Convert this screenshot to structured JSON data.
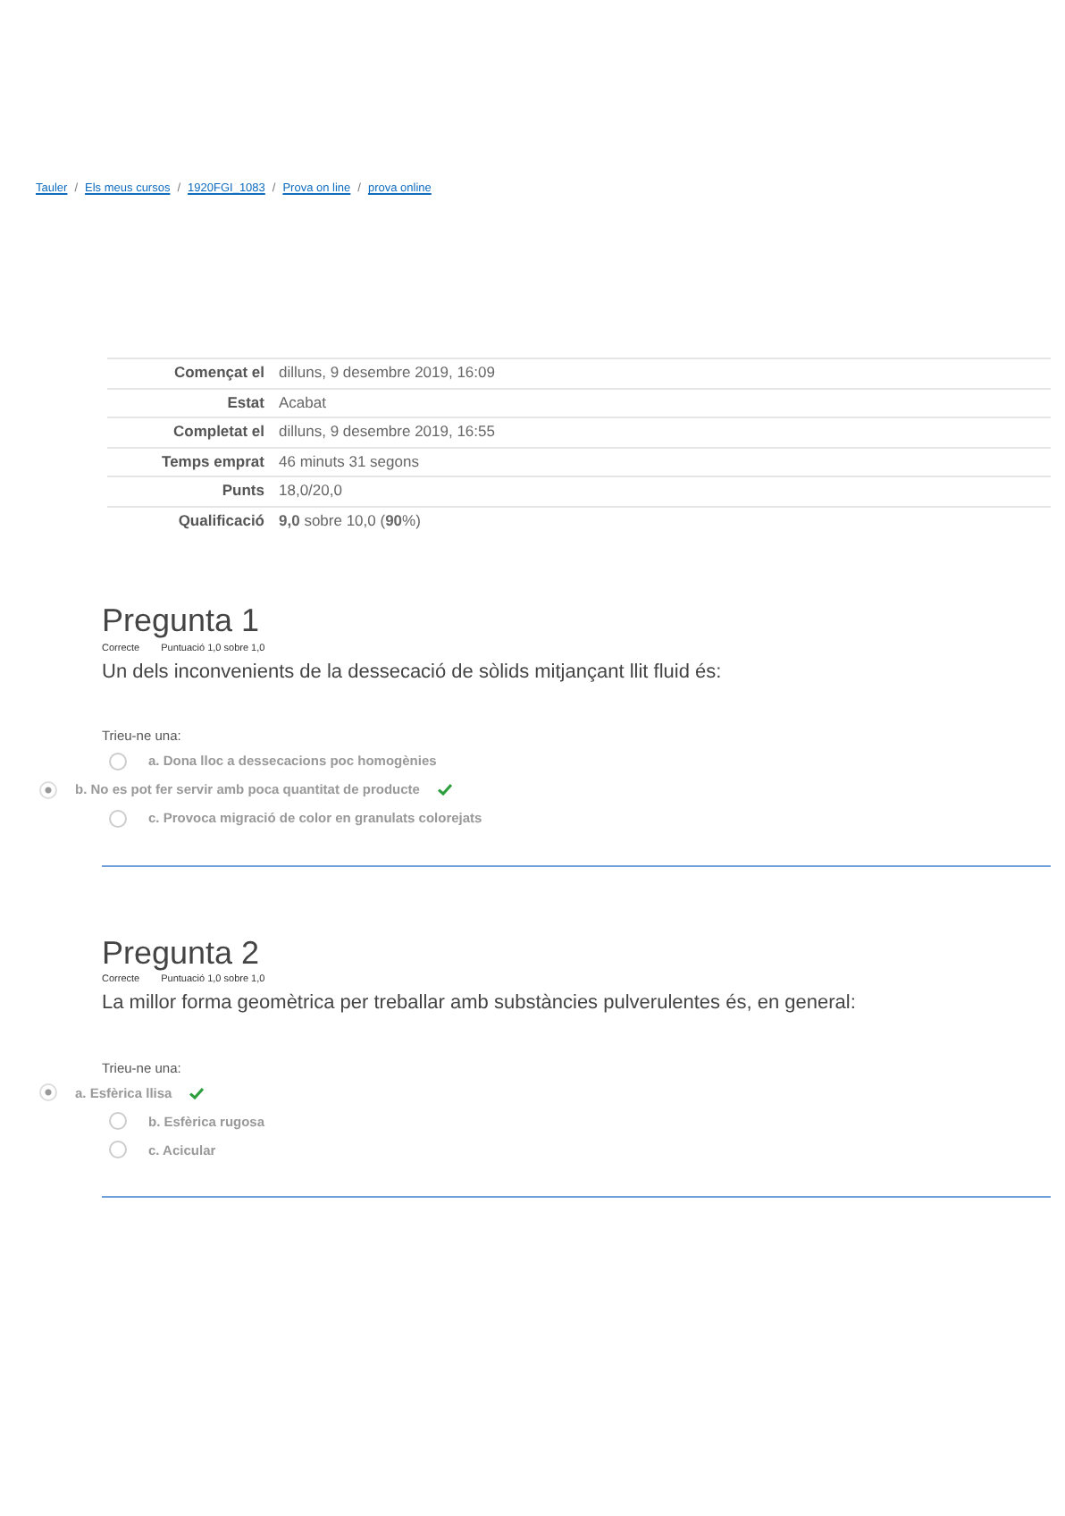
{
  "breadcrumb_separator": "/",
  "breadcrumb": [
    "Tauler",
    "Els meus cursos",
    "1920FGI_1083",
    "Prova on line",
    "prova online"
  ],
  "summary": [
    {
      "label": "Començat el",
      "value": "dilluns, 9 desembre 2019, 16:09"
    },
    {
      "label": "Estat",
      "value": "Acabat"
    },
    {
      "label": "Completat el",
      "value": "dilluns, 9 desembre 2019, 16:55"
    },
    {
      "label": "Temps emprat",
      "value": "46 minuts 31 segons"
    },
    {
      "label": "Punts",
      "value": "18,0/20,0"
    },
    {
      "label": "Qualificació",
      "value": "**9,0** sobre 10,0 (**90**%)"
    }
  ],
  "questions": [
    {
      "title": "Pregunta 1",
      "status": "Correcte",
      "score": "Puntuació 1,0 sobre 1,0",
      "text": "Un dels inconvenients de la dessecació de sòlids mitjançant llit fluid és:",
      "prompt": "Trieu-ne una:",
      "options": [
        {
          "label": "a. Dona lloc a dessecacions poc  homogènies",
          "selected": false,
          "correct": false
        },
        {
          "label": "b. No es pot fer servir amb poca quantitat de producte",
          "selected": true,
          "correct": true
        },
        {
          "label": "c. Provoca migració de color en granulats colorejats",
          "selected": false,
          "correct": false
        }
      ]
    },
    {
      "title": "Pregunta 2",
      "status": "Correcte",
      "score": "Puntuació 1,0 sobre 1,0",
      "text": "La millor forma geomètrica per treballar amb substàncies pulverulentes és, en general:",
      "prompt": "Trieu-ne una:",
      "options": [
        {
          "label": "a. Esfèrica llisa",
          "selected": true,
          "correct": true
        },
        {
          "label": "b. Esfèrica rugosa",
          "selected": false,
          "correct": false
        },
        {
          "label": "c. Acicular",
          "selected": false,
          "correct": false
        }
      ]
    }
  ]
}
